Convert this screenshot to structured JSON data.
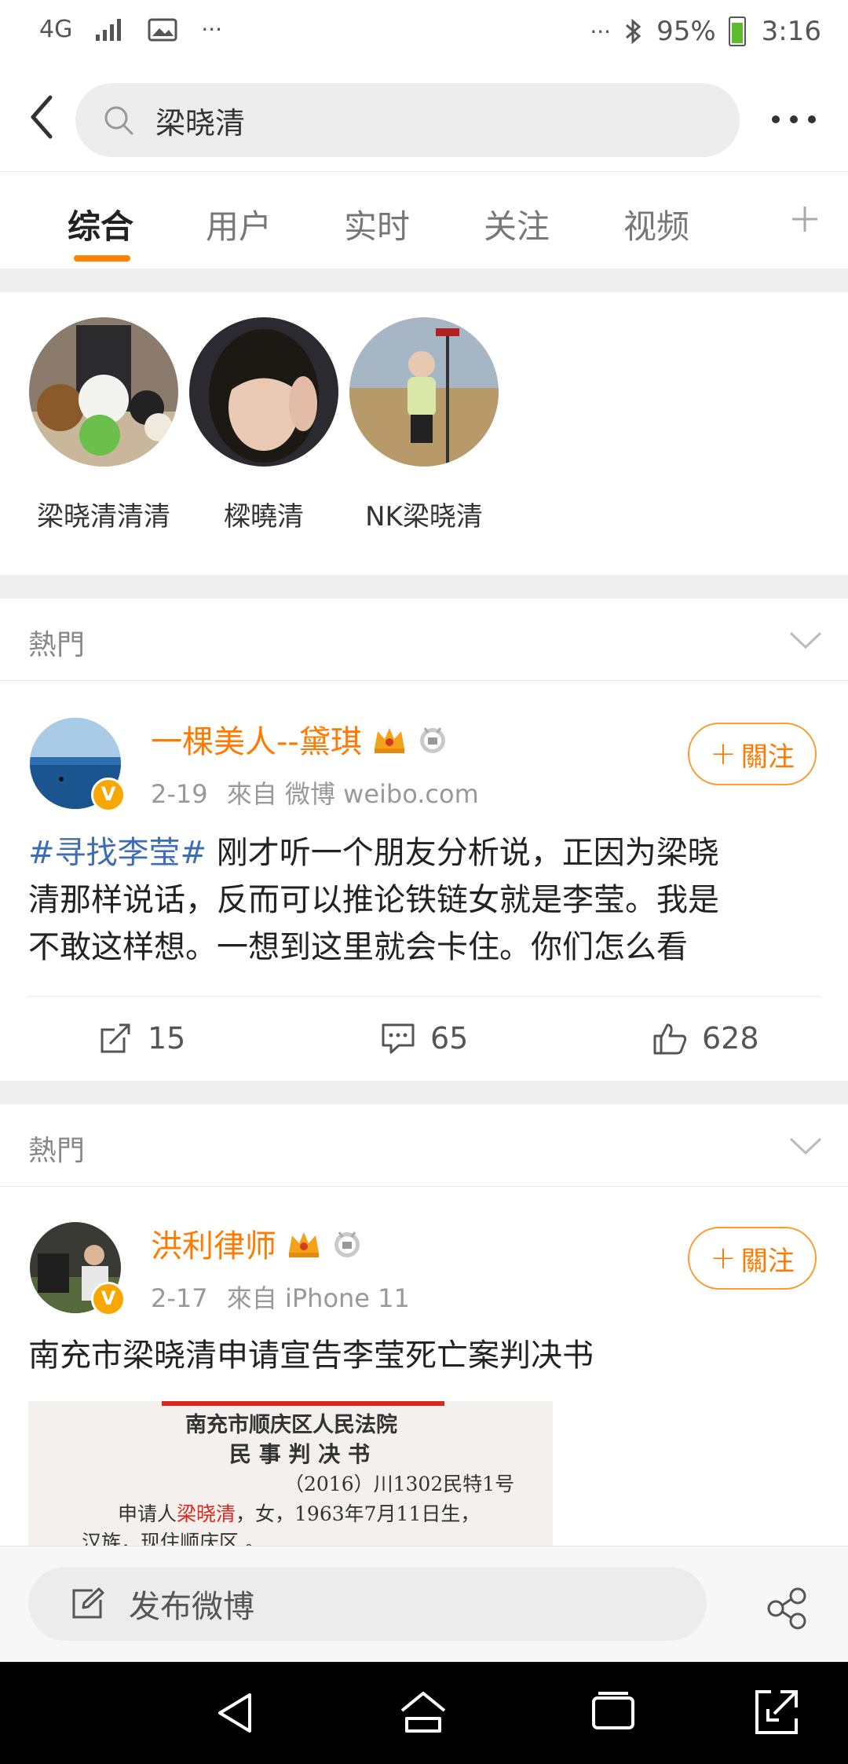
{
  "status_bar": {
    "network": "4G",
    "more_dots": "···",
    "battery_percent": "95%",
    "time": "3:16"
  },
  "search": {
    "query": "梁晓清"
  },
  "tabs": [
    {
      "label": "综合",
      "active": true
    },
    {
      "label": "用户",
      "active": false
    },
    {
      "label": "实时",
      "active": false
    },
    {
      "label": "关注",
      "active": false
    },
    {
      "label": "视频",
      "active": false
    }
  ],
  "users": [
    {
      "name": "梁晓清清清"
    },
    {
      "name": "樑曉清"
    },
    {
      "name": "NK梁晓清"
    }
  ],
  "posts": [
    {
      "section_label": "熱門",
      "author": "一棵美人--黛琪",
      "date": "2-19",
      "source": "來自 微博 weibo.com",
      "follow_label": "關注",
      "hashtag": "#寻找李莹#",
      "text_line1": " 刚才听一个朋友分析说，正因为梁晓",
      "text_line2": "清那样说话，反而可以推论铁链女就是李莹。我是",
      "text_line3": "不敢这样想。一想到这里就会卡住。你们怎么看",
      "reposts": "15",
      "comments": "65",
      "likes": "628"
    },
    {
      "section_label": "熱門",
      "author": "洪利律师",
      "date": "2-17",
      "source": "來自 iPhone 11",
      "follow_label": "關注",
      "text": "南充市梁晓清申请宣告李莹死亡案判决书",
      "document": {
        "court": "南充市顺庆区人民法院",
        "doc_type": "民 事 判 决 书",
        "case_no": "（2016）川1302民特1号",
        "line1_prefix": "申请人",
        "line1_name": "梁晓清",
        "line1_suffix": "，女，1963年7月11日生，",
        "line2": "汉族，现住顺庆区 。"
      }
    }
  ],
  "compose": {
    "label": "发布微博"
  },
  "colors": {
    "accent_orange": "#ff8200",
    "hashtag_blue": "#3f6db3",
    "verified_badge": "#f7a800"
  }
}
